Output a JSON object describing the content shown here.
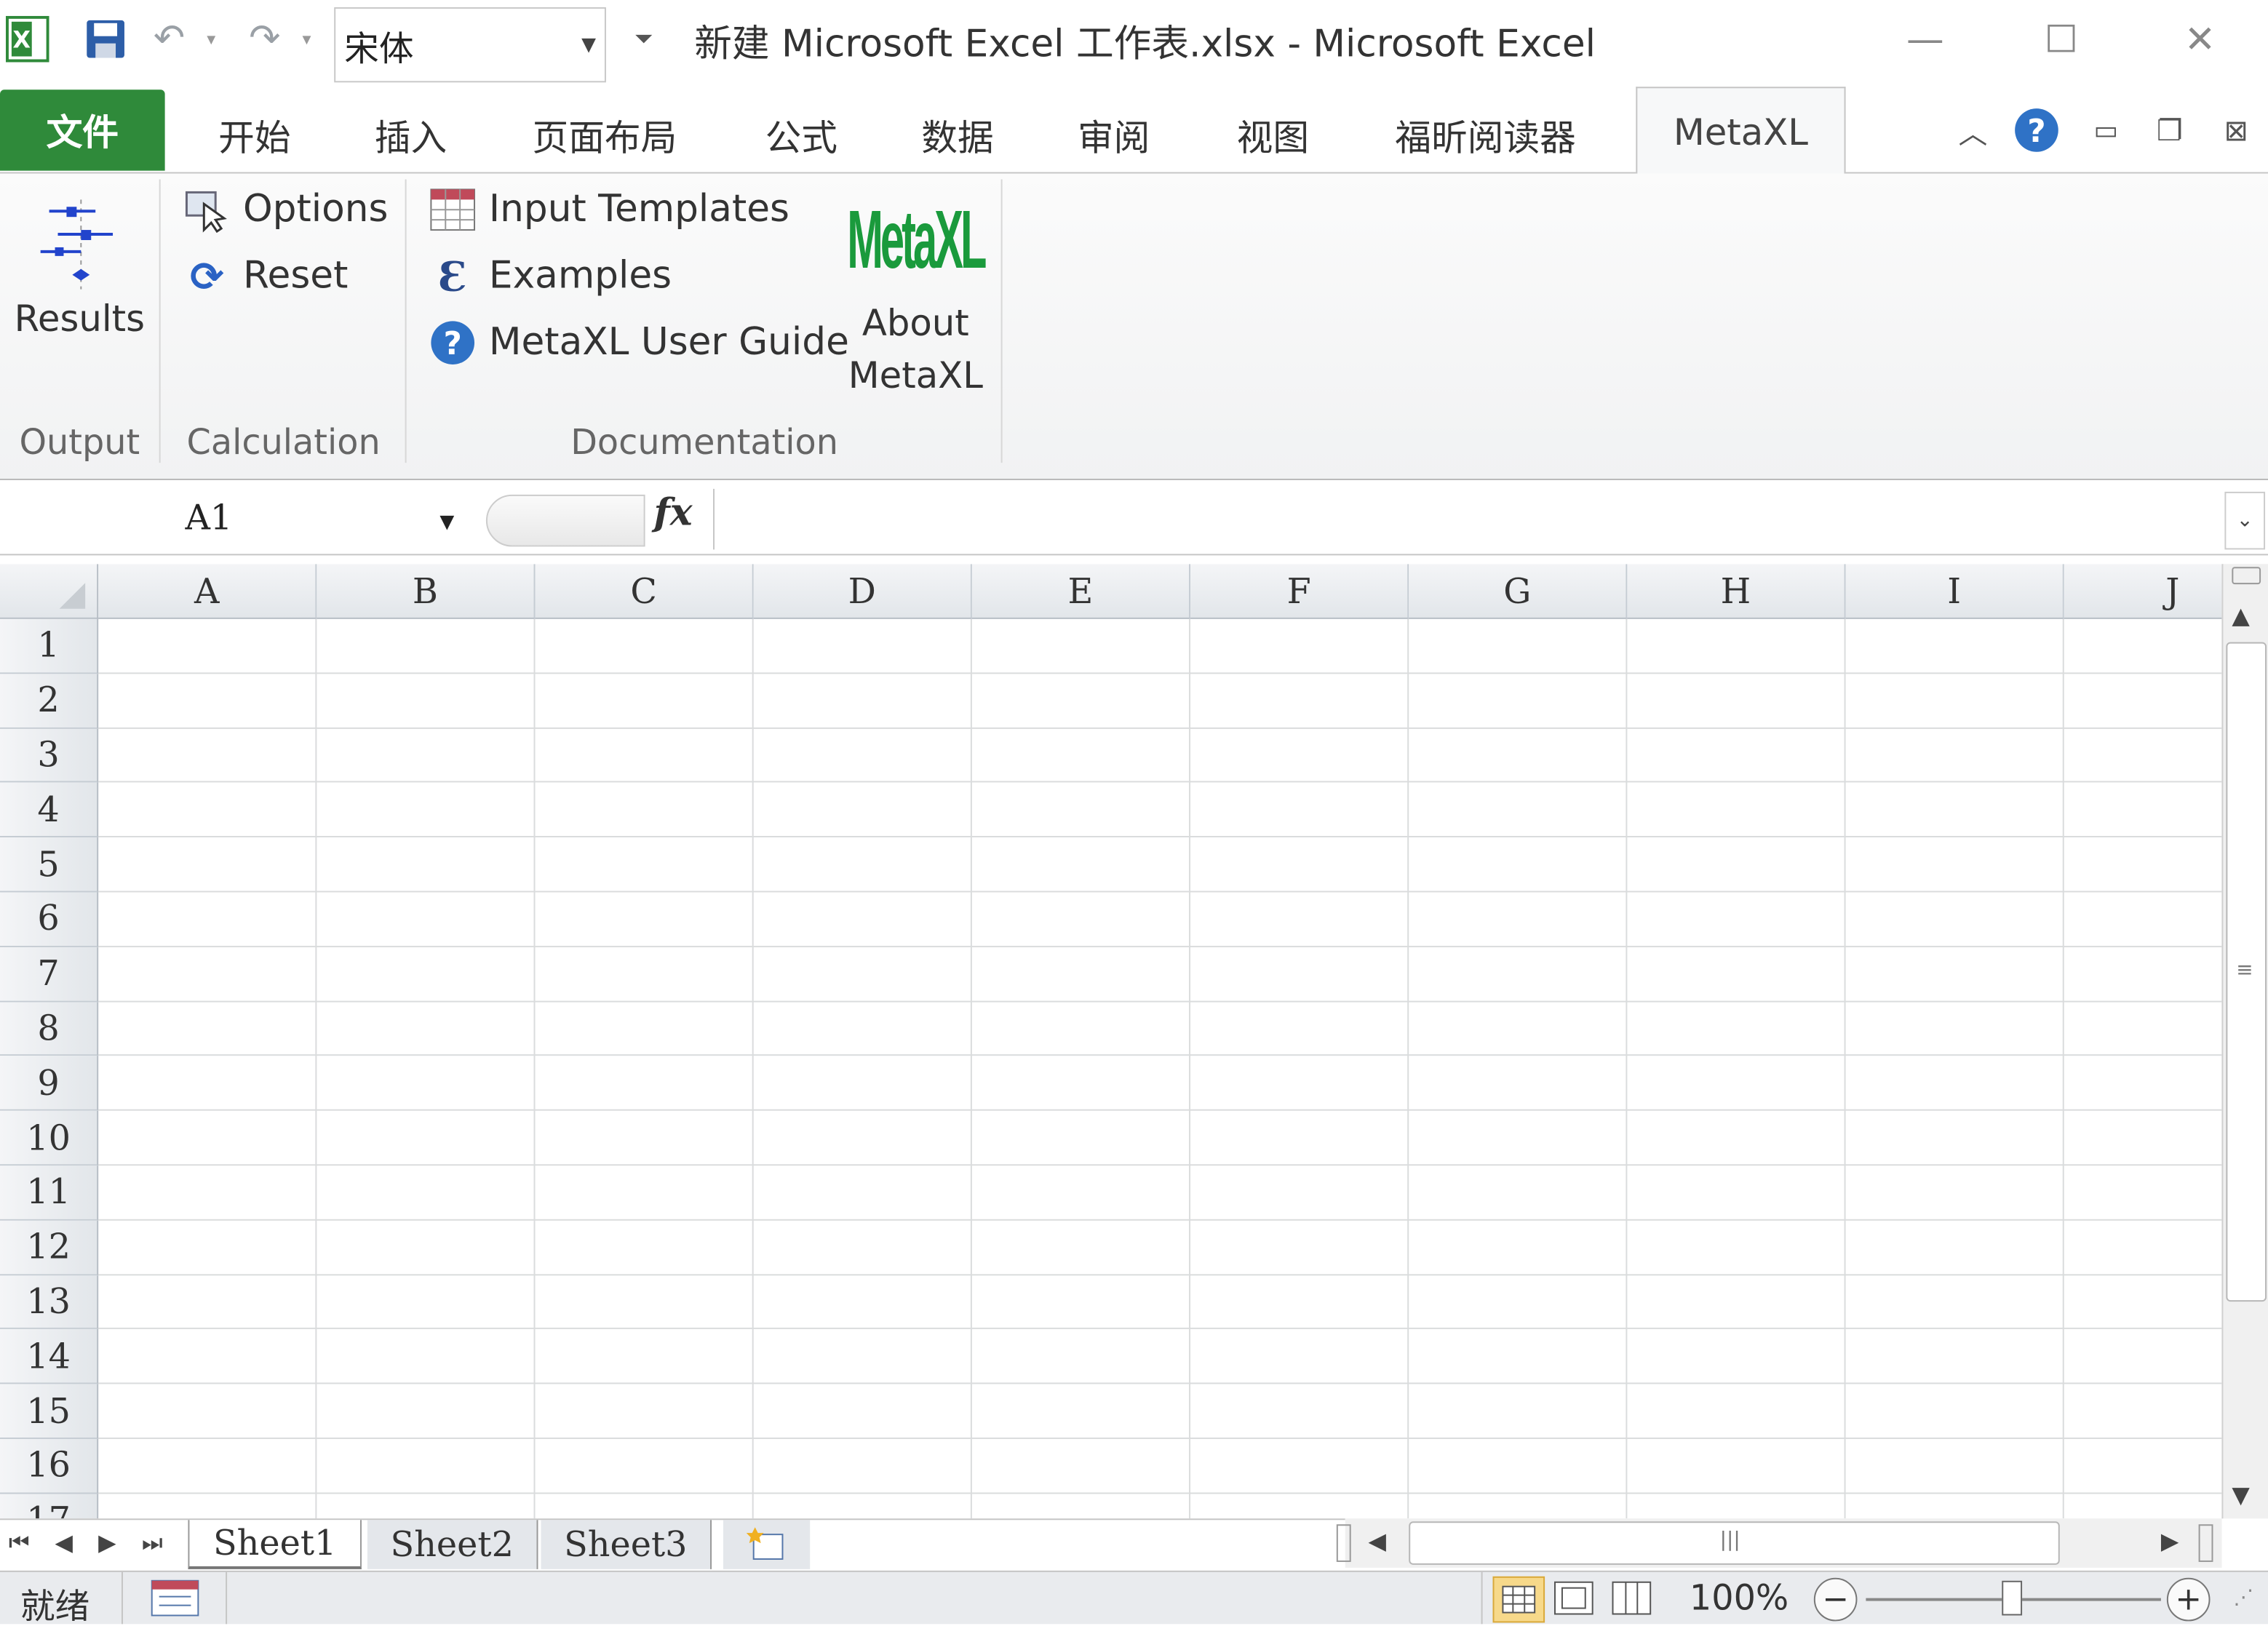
{
  "window": {
    "title": "新建 Microsoft Excel 工作表.xlsx  -  Microsoft Excel",
    "font_name": "宋体"
  },
  "tabs": [
    {
      "label": "文件",
      "selected": false
    },
    {
      "label": "开始"
    },
    {
      "label": "插入"
    },
    {
      "label": "页面布局"
    },
    {
      "label": "公式"
    },
    {
      "label": "数据"
    },
    {
      "label": "审阅"
    },
    {
      "label": "视图"
    },
    {
      "label": "福昕阅读器"
    },
    {
      "label": "MetaXL",
      "selected": true
    }
  ],
  "ribbon": {
    "results_label": "Results",
    "options_label": "Options",
    "reset_label": "Reset",
    "input_templates_label": "Input Templates",
    "examples_label": "Examples",
    "user_guide_label": "MetaXL User Guide",
    "about_line1": "About",
    "about_line2": "MetaXL",
    "logo_text": "MetaXL",
    "groups": {
      "output": "Output",
      "calculation": "Calculation",
      "documentation": "Documentation"
    }
  },
  "formula_bar": {
    "name_box": "A1",
    "fx": "fx",
    "formula": ""
  },
  "grid": {
    "columns": [
      "A",
      "B",
      "C",
      "D",
      "E",
      "F",
      "G",
      "H",
      "I",
      "J"
    ],
    "rows": [
      "1",
      "2",
      "3",
      "4",
      "5",
      "6",
      "7",
      "8",
      "9",
      "10",
      "11",
      "12",
      "13",
      "14",
      "15",
      "16",
      "17"
    ]
  },
  "sheets": [
    "Sheet1",
    "Sheet2",
    "Sheet3"
  ],
  "status": {
    "ready": "就绪",
    "zoom": "100%"
  },
  "colors": {
    "file_tab": "#2f8a3a",
    "logo": "#1a9a3c",
    "help": "#2f72c6"
  }
}
